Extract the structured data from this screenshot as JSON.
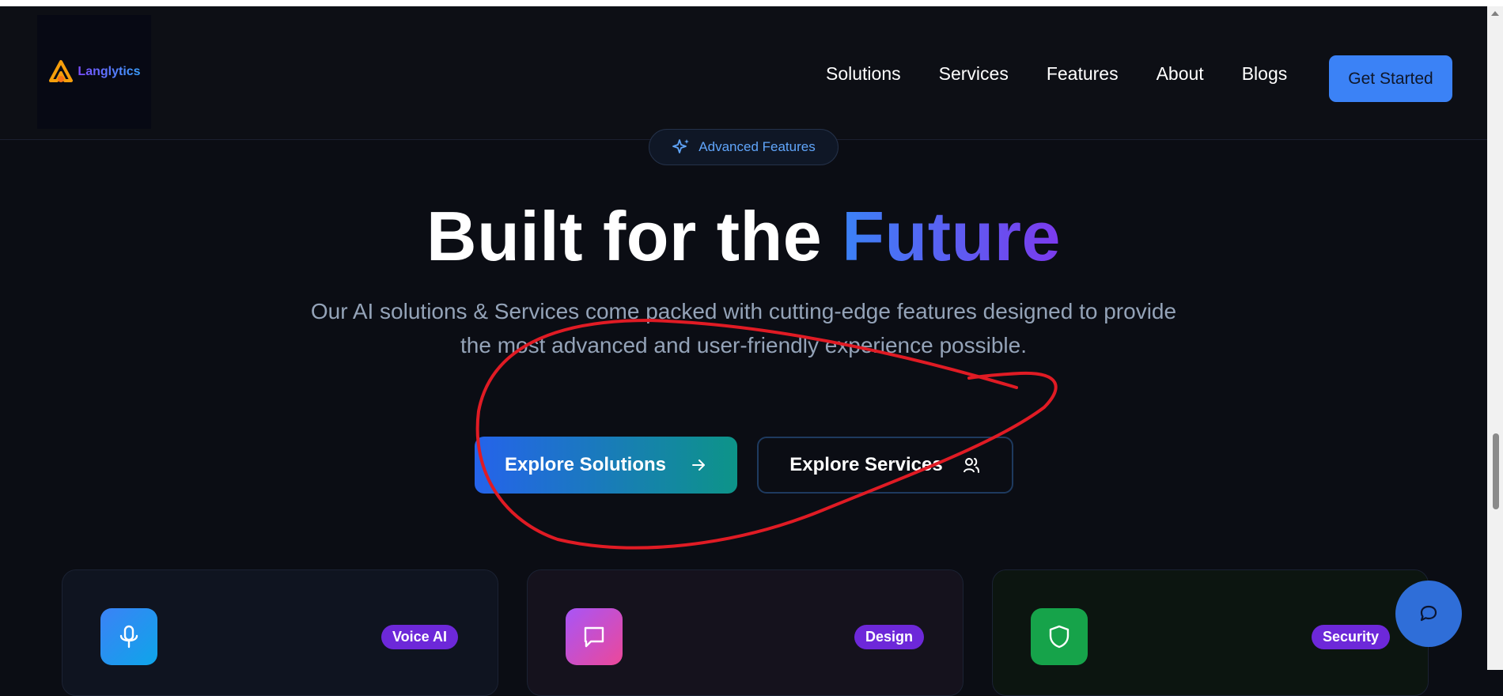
{
  "navbar": {
    "brand": "Langlytics",
    "links": [
      {
        "label": "Solutions"
      },
      {
        "label": "Services"
      },
      {
        "label": "Features"
      },
      {
        "label": "About"
      },
      {
        "label": "Blogs"
      }
    ],
    "cta_label": "Get Started"
  },
  "hero": {
    "pill_label": "Advanced Features",
    "headline_main": "Built for the",
    "headline_accent": "Future",
    "subtitle": "Our AI solutions & Services come packed with cutting-edge features designed to provide the most advanced and user-friendly experience possible.",
    "primary_button": "Explore Solutions",
    "secondary_button": "Explore Services"
  },
  "cards": [
    {
      "badge": "Voice AI",
      "icon": "microphone-icon"
    },
    {
      "badge": "Design",
      "icon": "chat-bubble-icon"
    },
    {
      "badge": "Security",
      "icon": "shield-icon"
    }
  ],
  "colors": {
    "background": "#0b0d14",
    "accent_blue": "#3b82f6",
    "accent_purple": "#7c3aed",
    "badge_purple": "#6d28d9",
    "annotation_red": "#e01b24"
  }
}
